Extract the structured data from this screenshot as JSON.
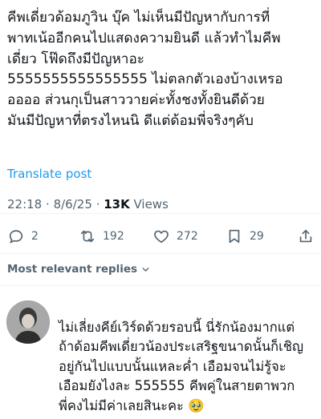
{
  "post": {
    "lines": [
      "คีพเดี่ยวด้อมภูวิน บุ๊ค ไม่เห็นมีปัญหากับการที่",
      "พาทเน้ออีกคนไปแสดงความยินดี แล้วทำไมคีพ",
      "เดี่ยว โฟ๊ดถึงมีปัญหาอะ",
      "5555555555555555 ไม่ตลกตัวเองบ้างเหรอ",
      "ออออ ส่วนกุเป็นสาววายค่ะทั้งชงทั้งยินดีด้วย",
      "มันมีปัญหาที่ตรงไหนนิ ดีแต่ด้อมพี่จริงๆคับ"
    ],
    "translate_label": "Translate post",
    "time": "22:18",
    "date": "8/6/25",
    "separator": "·",
    "views_count": "13K",
    "views_label": "Views"
  },
  "actions": {
    "replies": "2",
    "reposts": "192",
    "likes": "272",
    "bookmarks": "29"
  },
  "replies_filter": {
    "label": "Most relevant replies"
  },
  "reply": {
    "lines": [
      "ไม่เลี่ยงคีย์เวิร์ดด้วยรอบนี้ นี่รักน้องมากแต่",
      "ถ้าด้อมคีพเดี่ยวน้องประเสริฐขนาดนั้นก็เชิญ",
      "อยู่กันไปแบบนั้นแหละค่ำ เอือมจนไม่รู้จะ",
      "เอือมยังไงละ 555555 คีพคู่ในสายตาพวก",
      "พี่คงไม่มีค่าเลยสินะคะ 🥹"
    ]
  }
}
